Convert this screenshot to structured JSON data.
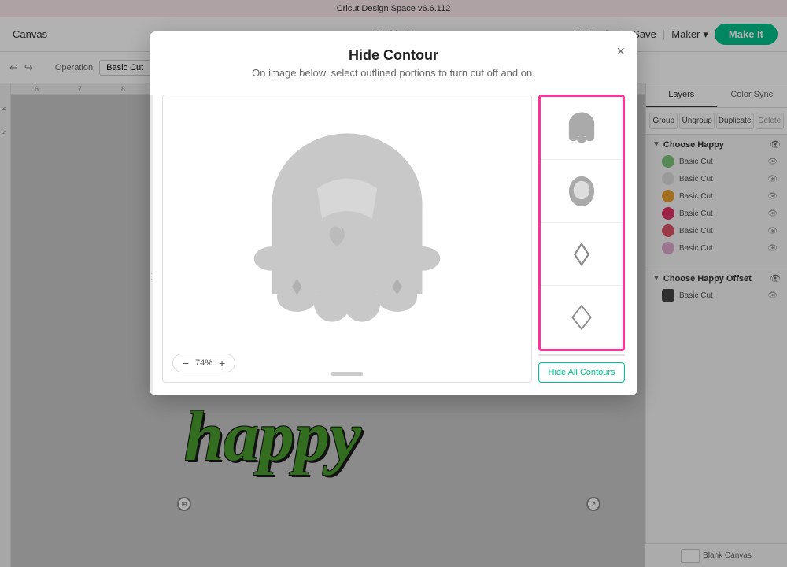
{
  "title_bar": {
    "text": "Cricut Design Space  v6.6.112"
  },
  "app_bar": {
    "canvas_label": "Canvas",
    "project_name": "Untitled*",
    "my_projects": "My Projects",
    "save": "Save",
    "separator": "|",
    "maker": "Maker",
    "make_it": "Make It"
  },
  "operation_bar": {
    "label": "Operation",
    "operation": "Basic Cut",
    "color": "#333333"
  },
  "modal": {
    "title": "Hide Contour",
    "subtitle": "On image below, select outlined portions to turn cut off and on.",
    "close_label": "×",
    "zoom_percent": "74%",
    "hide_all_label": "Hide All Contours"
  },
  "right_panel": {
    "tabs": [
      {
        "label": "Layers",
        "active": true
      },
      {
        "label": "Color Sync",
        "active": false
      }
    ],
    "actions": [
      {
        "label": "Group"
      },
      {
        "label": "Ungroup"
      },
      {
        "label": "Duplicate"
      },
      {
        "label": "Delete"
      }
    ],
    "groups": [
      {
        "name": "Choose Happy",
        "items": [
          {
            "color": "#7bc47a",
            "label": "Basic Cut"
          },
          {
            "color": "#cccccc",
            "label": "Basic Cut"
          },
          {
            "color": "#e8a030",
            "label": "Basic Cut"
          },
          {
            "color": "#cc3355",
            "label": "Basic Cut"
          },
          {
            "color": "#dd5566",
            "label": "Basic Cut"
          },
          {
            "color": "#dd88aa",
            "label": "Basic Cut"
          }
        ]
      },
      {
        "name": "Choose Happy Offset",
        "items": [
          {
            "color": "#333333",
            "label": "Basic Cut"
          }
        ]
      }
    ]
  },
  "contour_items": [
    {
      "id": 1,
      "shape": "ghost-body"
    },
    {
      "id": 2,
      "shape": "ghost-head"
    },
    {
      "id": 3,
      "shape": "diamond-small"
    },
    {
      "id": 4,
      "shape": "diamond-outline"
    }
  ],
  "canvas": {
    "happy_text": "happy"
  }
}
